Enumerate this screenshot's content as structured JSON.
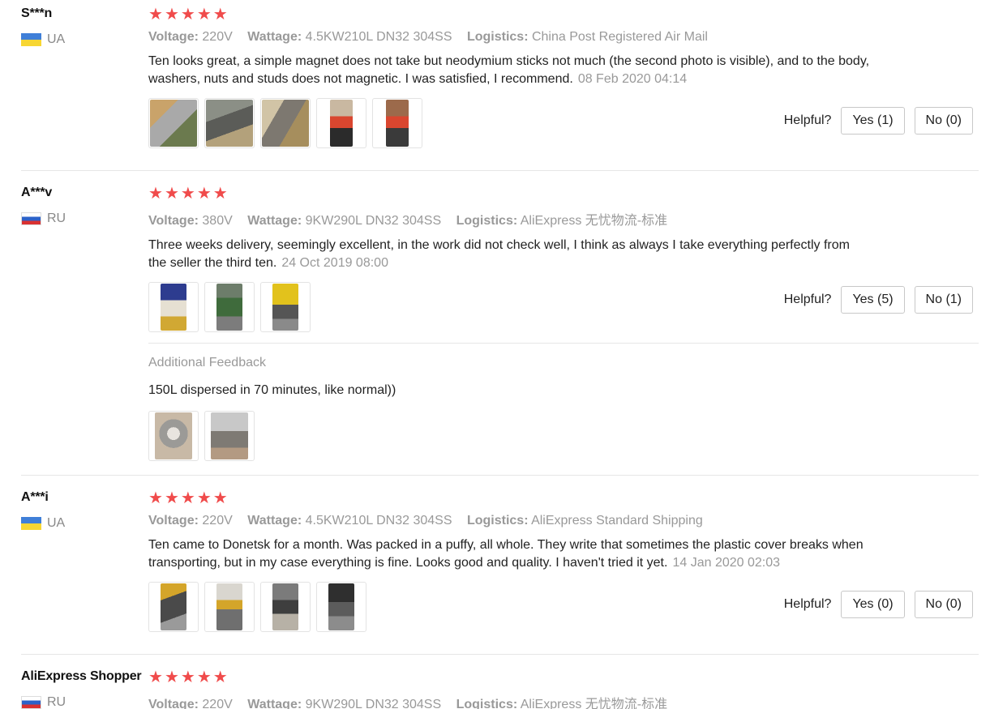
{
  "labels": {
    "helpful": "Helpful?",
    "voltage_key": "Voltage:",
    "wattage_key": "Wattage:",
    "logistics_key": "Logistics:",
    "additional_feedback": "Additional Feedback"
  },
  "reviews": [
    {
      "user": "S***n",
      "country": "UA",
      "rating": 5,
      "voltage": "220V",
      "wattage": "4.5KW210L DN32 304SS",
      "logistics": "China Post Registered Air Mail",
      "text": "Ten looks great, a simple magnet does not take but neodymium sticks not much (the second photo is visible), and to the body, washers, nuts and studs does not magnetic. I was satisfied, I recommend.",
      "date": "08 Feb 2020 04:14",
      "yes": "Yes (1)",
      "no": "No (0)"
    },
    {
      "user": "A***v",
      "country": "RU",
      "rating": 5,
      "voltage": "380V",
      "wattage": "9KW290L DN32 304SS",
      "logistics": "AliExpress 无忧物流-标准",
      "text": "Three weeks delivery, seemingly excellent, in the work did not check well, I think as always I take everything perfectly from the seller the third ten.",
      "date": "24 Oct 2019 08:00",
      "yes": "Yes (5)",
      "no": "No (1)",
      "additional_text": "150L dispersed in 70 minutes, like normal))"
    },
    {
      "user": "A***i",
      "country": "UA",
      "rating": 5,
      "voltage": "220V",
      "wattage": "4.5KW210L DN32 304SS",
      "logistics": "AliExpress Standard Shipping",
      "text": "Ten came to Donetsk for a month. Was packed in a puffy, all whole. They write that sometimes the plastic cover breaks when transporting, but in my case everything is fine. Looks good and quality. I haven't tried it yet.",
      "date": "14 Jan 2020 02:03",
      "yes": "Yes (0)",
      "no": "No (0)"
    },
    {
      "user": "AliExpress Shopper",
      "country": "RU",
      "rating": 5,
      "voltage": "220V",
      "wattage": "9KW290L DN32 304SS",
      "logistics": "AliExpress 无忧物流-标准"
    }
  ]
}
